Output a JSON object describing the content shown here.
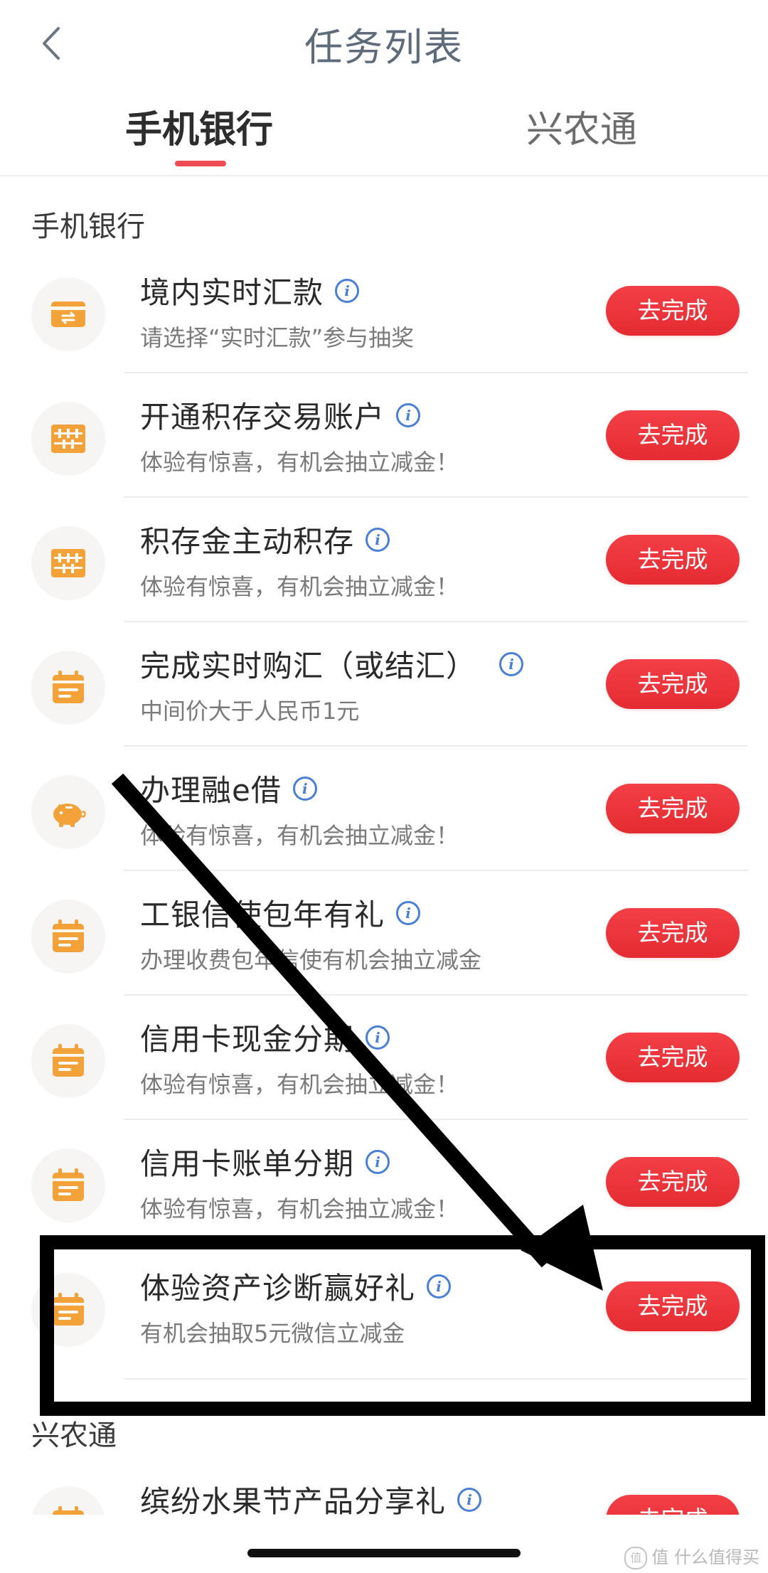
{
  "nav": {
    "title": "任务列表",
    "back_icon": "chevron-left-icon"
  },
  "tabs": [
    {
      "label": "手机银行",
      "active": true
    },
    {
      "label": "兴农通",
      "active": false
    }
  ],
  "sections": [
    {
      "title": "手机银行"
    },
    {
      "title": "兴农通"
    }
  ],
  "tasks": [
    {
      "icon": "card-transfer-icon",
      "title": "境内实时汇款",
      "subtitle": "请选择“实时汇款”参与抽奖",
      "button": "去完成"
    },
    {
      "icon": "abacus-icon",
      "title": "开通积存交易账户",
      "subtitle": "体验有惊喜，有机会抽立减金！",
      "button": "去完成"
    },
    {
      "icon": "abacus-icon",
      "title": "积存金主动积存",
      "subtitle": "体验有惊喜，有机会抽立减金！",
      "button": "去完成"
    },
    {
      "icon": "calendar-icon",
      "title": "完成实时购汇（或结汇）",
      "subtitle": "中间价大于人民币1元",
      "button": "去完成"
    },
    {
      "icon": "piggy-bank-icon",
      "title": "办理融e借",
      "subtitle": "体验有惊喜，有机会抽立减金！",
      "button": "去完成"
    },
    {
      "icon": "calendar-icon",
      "title": "工银信使包年有礼",
      "subtitle": "办理收费包年信使有机会抽立减金",
      "button": "去完成"
    },
    {
      "icon": "calendar-icon",
      "title": "信用卡现金分期",
      "subtitle": "体验有惊喜，有机会抽立减金！",
      "button": "去完成"
    },
    {
      "icon": "calendar-icon",
      "title": "信用卡账单分期",
      "subtitle": "体验有惊喜，有机会抽立减金！",
      "button": "去完成"
    },
    {
      "icon": "calendar-icon",
      "title": "体验资产诊断赢好礼",
      "subtitle": "有机会抽取5元微信立减金",
      "button": "去完成"
    },
    {
      "icon": "calendar-icon",
      "title": "缤纷水果节产品分享礼",
      "subtitle": "",
      "button": "去完成"
    }
  ],
  "info_icon_glyph": "i",
  "watermark": {
    "text": "值 什么值得买",
    "icon_glyph": "值"
  },
  "colors": {
    "accent_red": "#e52b32",
    "tab_indicator": "#ef4b55",
    "icon_orange": "#f3a23a",
    "info_blue": "#4a7fd6",
    "annotation": "#000000"
  }
}
